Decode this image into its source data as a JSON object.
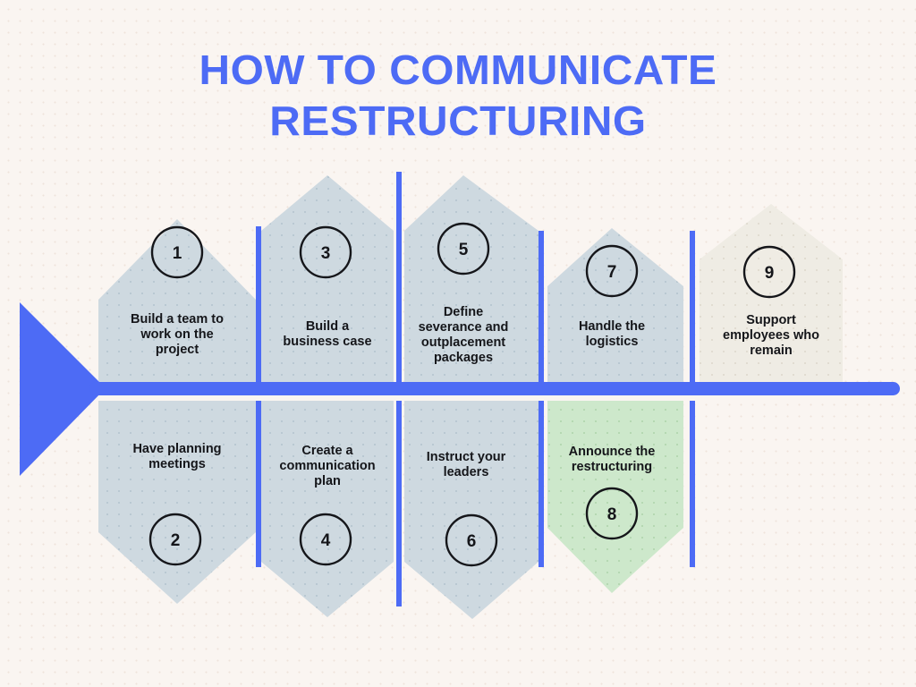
{
  "title": {
    "line1": "HOW TO COMMUNICATE",
    "line2": "RESTRUCTURING"
  },
  "colors": {
    "background": "#faf5f1",
    "accent_blue": "#4d6bf5",
    "node_blue_grey": "#ced9e0",
    "node_green": "#cde8cb",
    "node_beige": "#efece4",
    "text_dark": "#15161a"
  },
  "chart_data": {
    "type": "diagram",
    "diagram_style": "fishbone-timeline",
    "title": "HOW TO COMMUNICATE RESTRUCTURING",
    "step_count": 9,
    "steps": [
      {
        "number": "1",
        "label": "Build a team to work on the project",
        "row": "top",
        "color": "#ced9e0"
      },
      {
        "number": "2",
        "label": "Have planning meetings",
        "row": "bottom",
        "color": "#ced9e0"
      },
      {
        "number": "3",
        "label": "Build a business case",
        "row": "top",
        "color": "#ced9e0"
      },
      {
        "number": "4",
        "label": "Create a communication plan",
        "row": "bottom",
        "color": "#ced9e0"
      },
      {
        "number": "5",
        "label": "Define severance and outplacement packages",
        "row": "top",
        "color": "#ced9e0"
      },
      {
        "number": "6",
        "label": "Instruct your leaders",
        "row": "bottom",
        "color": "#ced9e0"
      },
      {
        "number": "7",
        "label": "Handle the logistics",
        "row": "top",
        "color": "#ced9e0"
      },
      {
        "number": "8",
        "label": "Announce the restructuring",
        "row": "bottom",
        "color": "#cde8cb"
      },
      {
        "number": "9",
        "label": "Support employees who remain",
        "row": "top",
        "color": "#efece4"
      }
    ]
  },
  "nodes": {
    "n1": {
      "number": "1",
      "line1": "Build a team to",
      "line2": "work on the",
      "line3": "project"
    },
    "n2": {
      "number": "2",
      "line1": "Have planning",
      "line2": "meetings",
      "line3": ""
    },
    "n3": {
      "number": "3",
      "line1": "Build a",
      "line2": "business case",
      "line3": ""
    },
    "n4": {
      "number": "4",
      "line1": "Create a",
      "line2": "communication",
      "line3": "plan"
    },
    "n5": {
      "number": "5",
      "line1": "Define",
      "line2": "severance and",
      "line3": "outplacement",
      "line4": "packages"
    },
    "n6": {
      "number": "6",
      "line1": "Instruct your",
      "line2": "leaders",
      "line3": ""
    },
    "n7": {
      "number": "7",
      "line1": "Handle the",
      "line2": "logistics",
      "line3": ""
    },
    "n8": {
      "number": "8",
      "line1": "Announce the",
      "line2": "restructuring",
      "line3": ""
    },
    "n9": {
      "number": "9",
      "line1": "Support",
      "line2": "employees who",
      "line3": "remain"
    }
  }
}
